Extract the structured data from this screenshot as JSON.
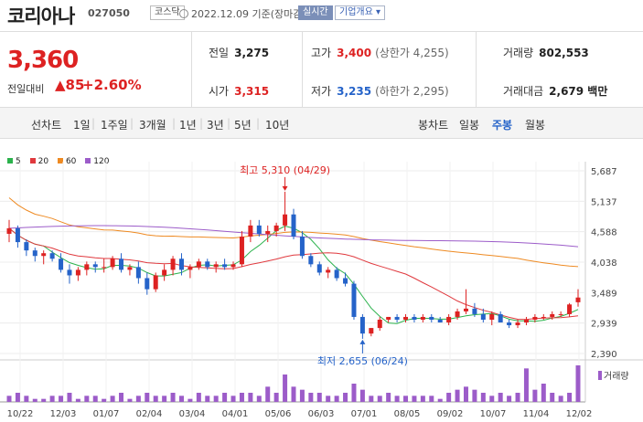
{
  "header": {
    "name": "코리아나",
    "code": "027050",
    "market": "코스닥",
    "date_text": "2022.12.09 기준(장마감)",
    "realtime": "실시간",
    "company_info": "기업개요 ▾"
  },
  "quote": {
    "price": "3,360",
    "change_label": "전일대비",
    "change_value": "▲85",
    "change_pct": "+2.60%",
    "prev_close_label": "전일",
    "prev_close": "3,275",
    "high_label": "고가",
    "high": "3,400",
    "upper_limit": "(상한가 4,255)",
    "volume_label": "거래량",
    "volume": "802,553",
    "open_label": "시가",
    "open": "3,315",
    "low_label": "저가",
    "low": "3,235",
    "lower_limit": "(하한가 2,295)",
    "amount_label": "거래대금",
    "amount": "2,679 백만"
  },
  "tabs": {
    "line_label": "선차트",
    "periods": [
      "1일",
      "1주일",
      "3개월",
      "1년",
      "3년",
      "5년",
      "10년"
    ],
    "candle_label": "봉차트",
    "candle_periods": [
      "일봉",
      "주봉",
      "월봉"
    ],
    "active_candle": "주봉"
  },
  "legend": [
    {
      "label": "5",
      "color": "#2bb24c"
    },
    {
      "label": "20",
      "color": "#e0393e"
    },
    {
      "label": "60",
      "color": "#ee8a22"
    },
    {
      "label": "120",
      "color": "#9c5cc9"
    }
  ],
  "colors": {
    "up": "#dd2222",
    "down": "#2563c9",
    "volume": "#9c5cc9"
  },
  "chart_data": {
    "type": "candlestick",
    "y_ticks": [
      "5,687",
      "5,137",
      "4,588",
      "4,038",
      "3,489",
      "2,939",
      "2,390"
    ],
    "ylim": [
      2390,
      5687
    ],
    "x_labels": [
      "10/22",
      "12/03",
      "01/07",
      "02/04",
      "03/04",
      "04/01",
      "05/06",
      "06/03",
      "07/01",
      "08/05",
      "09/02",
      "10/07",
      "11/04",
      "12/02"
    ],
    "annotation_high": "최고 5,310 (04/29)",
    "annotation_low": "최저 2,655 (06/24)",
    "volume_label": "거래량",
    "candles": [
      [
        4550,
        4800,
        4400,
        4650
      ],
      [
        4650,
        4700,
        4300,
        4400
      ],
      [
        4400,
        4450,
        4150,
        4250
      ],
      [
        4250,
        4300,
        4050,
        4150
      ],
      [
        4150,
        4250,
        4000,
        4200
      ],
      [
        4200,
        4250,
        4050,
        4100
      ],
      [
        4100,
        4200,
        3850,
        3900
      ],
      [
        3900,
        4000,
        3650,
        3800
      ],
      [
        3800,
        3950,
        3700,
        3900
      ],
      [
        3900,
        4050,
        3800,
        4000
      ],
      [
        4000,
        4050,
        3850,
        3950
      ],
      [
        3950,
        4100,
        3850,
        3950
      ],
      [
        3950,
        4150,
        3900,
        4100
      ],
      [
        4100,
        4200,
        3850,
        3900
      ],
      [
        3900,
        4000,
        3800,
        3950
      ],
      [
        3950,
        4050,
        3650,
        3750
      ],
      [
        3750,
        3850,
        3450,
        3550
      ],
      [
        3550,
        3850,
        3500,
        3800
      ],
      [
        3800,
        4000,
        3700,
        3900
      ],
      [
        3900,
        4150,
        3800,
        4100
      ],
      [
        4100,
        4200,
        3800,
        3900
      ],
      [
        3900,
        4000,
        3750,
        3950
      ],
      [
        3950,
        4100,
        3900,
        4050
      ],
      [
        4050,
        4100,
        3900,
        3950
      ],
      [
        3950,
        4050,
        3850,
        4000
      ],
      [
        4000,
        4100,
        3900,
        3950
      ],
      [
        3950,
        4050,
        3900,
        4000
      ],
      [
        4000,
        4600,
        3950,
        4500
      ],
      [
        4500,
        4800,
        4400,
        4700
      ],
      [
        4700,
        4800,
        4500,
        4550
      ],
      [
        4550,
        4700,
        4400,
        4600
      ],
      [
        4600,
        4750,
        4500,
        4700
      ],
      [
        4700,
        5310,
        4600,
        4900
      ],
      [
        4900,
        5000,
        4450,
        4500
      ],
      [
        4500,
        4600,
        4100,
        4150
      ],
      [
        4150,
        4200,
        3950,
        4000
      ],
      [
        4000,
        4050,
        3800,
        3850
      ],
      [
        3850,
        3950,
        3750,
        3900
      ],
      [
        3900,
        3950,
        3700,
        3750
      ],
      [
        3750,
        3850,
        3600,
        3650
      ],
      [
        3650,
        3700,
        3000,
        3050
      ],
      [
        3050,
        3100,
        2655,
        2750
      ],
      [
        2750,
        2850,
        2700,
        2850
      ],
      [
        2850,
        3050,
        2800,
        3000
      ],
      [
        3000,
        3050,
        2950,
        3050
      ],
      [
        3050,
        3100,
        2950,
        3000
      ],
      [
        3000,
        3100,
        2950,
        3050
      ],
      [
        3050,
        3100,
        2950,
        3000
      ],
      [
        3000,
        3100,
        2950,
        3050
      ],
      [
        3050,
        3100,
        2950,
        3000
      ],
      [
        3000,
        3050,
        2950,
        2950
      ],
      [
        2950,
        3100,
        2900,
        3050
      ],
      [
        3050,
        3200,
        3000,
        3150
      ],
      [
        3150,
        3550,
        3100,
        3200
      ],
      [
        3200,
        3300,
        3050,
        3100
      ],
      [
        3100,
        3200,
        2950,
        3000
      ],
      [
        3000,
        3150,
        2900,
        3100
      ],
      [
        3100,
        3150,
        2950,
        2950
      ],
      [
        2950,
        3000,
        2850,
        2900
      ],
      [
        2900,
        3000,
        2850,
        2950
      ],
      [
        2950,
        3050,
        2900,
        3000
      ],
      [
        3000,
        3100,
        2950,
        3050
      ],
      [
        3050,
        3100,
        3000,
        3050
      ],
      [
        3050,
        3150,
        3000,
        3100
      ],
      [
        3100,
        3150,
        3050,
        3100
      ],
      [
        3100,
        3300,
        3050,
        3275
      ],
      [
        3315,
        3550,
        3235,
        3400
      ]
    ],
    "volumes": [
      2,
      3,
      2,
      1,
      1,
      2,
      2,
      3,
      1,
      2,
      2,
      1,
      2,
      3,
      1,
      2,
      3,
      2,
      2,
      3,
      2,
      1,
      3,
      2,
      2,
      3,
      2,
      3,
      3,
      2,
      5,
      3,
      9,
      5,
      4,
      3,
      3,
      2,
      2,
      3,
      6,
      4,
      2,
      2,
      3,
      2,
      2,
      2,
      2,
      2,
      1,
      3,
      4,
      5,
      4,
      3,
      2,
      3,
      2,
      3,
      11,
      4,
      6,
      3,
      2,
      3,
      12
    ]
  }
}
